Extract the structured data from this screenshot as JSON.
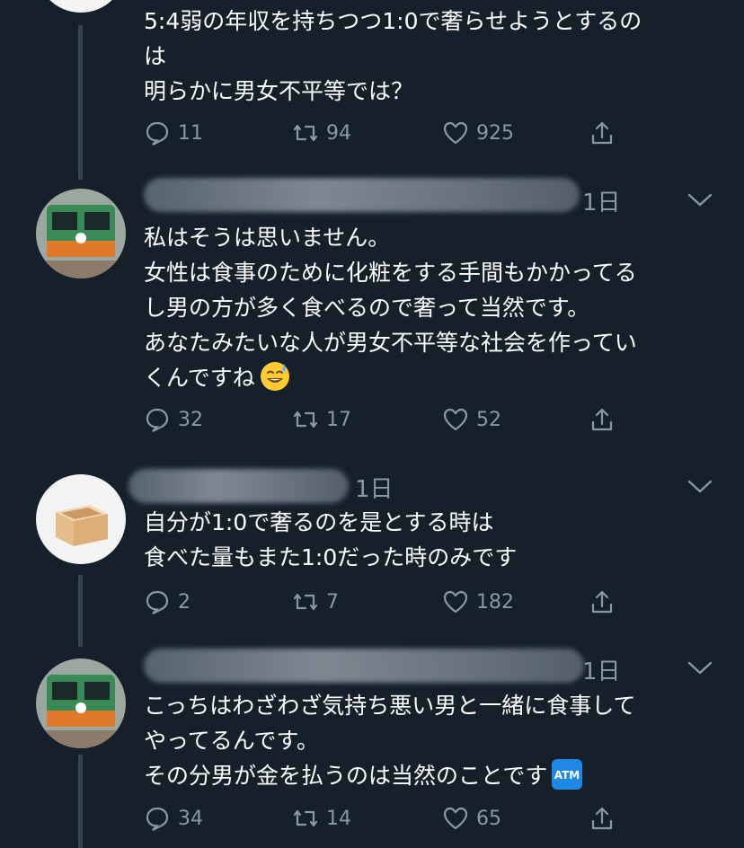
{
  "tweets": [
    {
      "text_lines": [
        "5:4弱の年収を持ちつつ1:0で奢らせようとするの",
        "は",
        "明らかに男女不平等では？"
      ],
      "reply_count": "11",
      "retweet_count": "94",
      "like_count": "925"
    },
    {
      "time": "1日",
      "text_lines": [
        "私はそうは思いません。",
        "女性は食事のために化粧をする手間もかかってる",
        "し男の方が多く食べるので奢って当然です。",
        "あなたみたいな人が男女不平等な社会を作ってい",
        "くんですね"
      ],
      "emoji": "sweat-smile-emoji",
      "reply_count": "32",
      "retweet_count": "17",
      "like_count": "52"
    },
    {
      "time": "1日",
      "text_lines": [
        "自分が1:0で奢るのを是とする時は",
        "食べた量もまた1:0だった時のみです"
      ],
      "reply_count": "2",
      "retweet_count": "7",
      "like_count": "182"
    },
    {
      "time": "1日",
      "text_lines": [
        "こっちはわざわざ気持ち悪い男と一緒に食事して",
        "やってるんです。",
        "その分男が金を払うのは当然のことです"
      ],
      "emoji_label": "ATM",
      "reply_count": "34",
      "retweet_count": "14",
      "like_count": "65"
    }
  ],
  "colors": {
    "background": "#15202b",
    "text": "#ffffff",
    "muted": "#8899a6",
    "thread_line": "#38444d",
    "atm_blue": "#1e88e5"
  }
}
